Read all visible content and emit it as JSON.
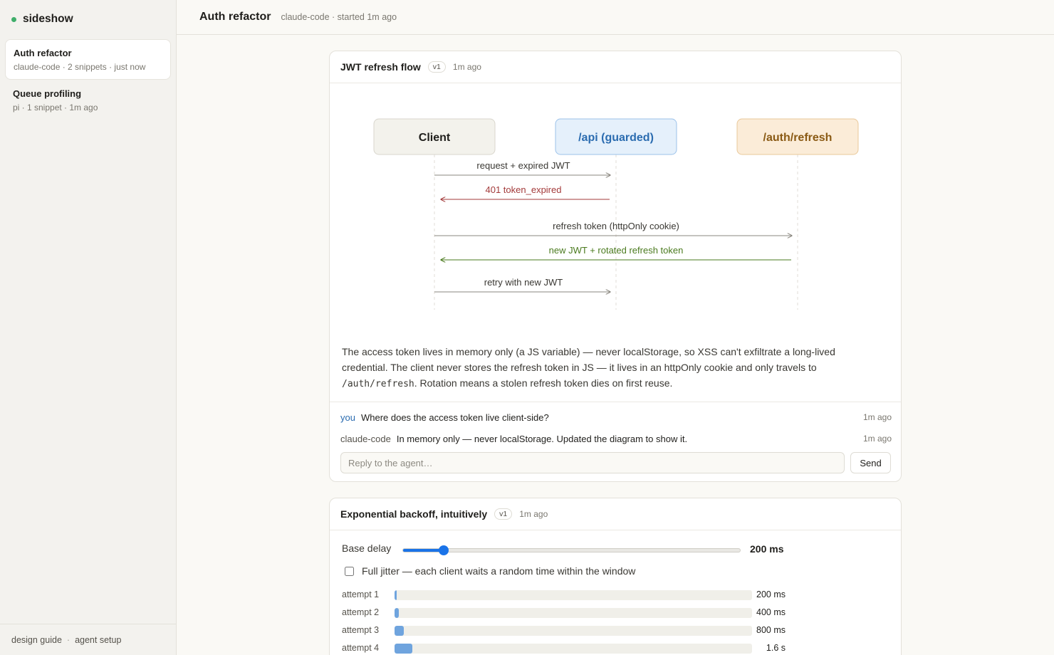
{
  "app": {
    "name": "sideshow"
  },
  "sidebar": {
    "sessions": [
      {
        "title": "Auth refactor",
        "meta": "claude-code · 2 snippets · just now",
        "active": true
      },
      {
        "title": "Queue profiling",
        "meta": "pi · 1 snippet · 1m ago",
        "active": false
      }
    ],
    "footer": {
      "design_guide": "design guide",
      "separator": "·",
      "agent_setup": "agent setup"
    }
  },
  "header": {
    "title": "Auth refactor",
    "meta": "claude-code · started 1m ago"
  },
  "snippet1": {
    "title": "JWT refresh flow",
    "version": "v1",
    "time": "1m ago",
    "participants": [
      "Client",
      "/api (guarded)",
      "/auth/refresh"
    ],
    "messages": [
      "request + expired JWT",
      "401 token_expired",
      "refresh token (httpOnly cookie)",
      "new JWT + rotated refresh token",
      "retry with new JWT"
    ],
    "desc_part1": "The access token lives in memory only (a JS variable) — never localStorage, so XSS can't exfiltrate a long-lived credential. The client never stores the refresh token in JS — it lives in an httpOnly cookie and only travels to ",
    "desc_code": "/auth/refresh",
    "desc_part2": ". Rotation means a stolen refresh token dies on first reuse.",
    "chat": [
      {
        "who": "you",
        "text": "Where does the access token live client-side?",
        "time": "1m ago"
      },
      {
        "who": "claude-code",
        "text": "In memory only — never localStorage. Updated the diagram to show it.",
        "time": "1m ago"
      }
    ],
    "reply_placeholder": "Reply to the agent…",
    "send_label": "Send",
    "colors": {
      "error": "#a33a3a",
      "success": "#4a7a1e",
      "api": "#2b6cb0",
      "auth": "#8a5a14"
    }
  },
  "snippet2": {
    "title": "Exponential backoff, intuitively",
    "version": "v1",
    "time": "1m ago",
    "slider_label": "Base delay",
    "slider_value": "200 ms",
    "slider_fraction": 0.12,
    "jitter_label": "Full jitter — each client waits a random time within the window",
    "jitter_checked": false,
    "attempts": [
      {
        "label": "attempt 1",
        "value": "200 ms",
        "fraction": 0.006
      },
      {
        "label": "attempt 2",
        "value": "400 ms",
        "fraction": 0.012
      },
      {
        "label": "attempt 3",
        "value": "800 ms",
        "fraction": 0.025
      },
      {
        "label": "attempt 4",
        "value": "1.6 s",
        "fraction": 0.05
      }
    ]
  }
}
